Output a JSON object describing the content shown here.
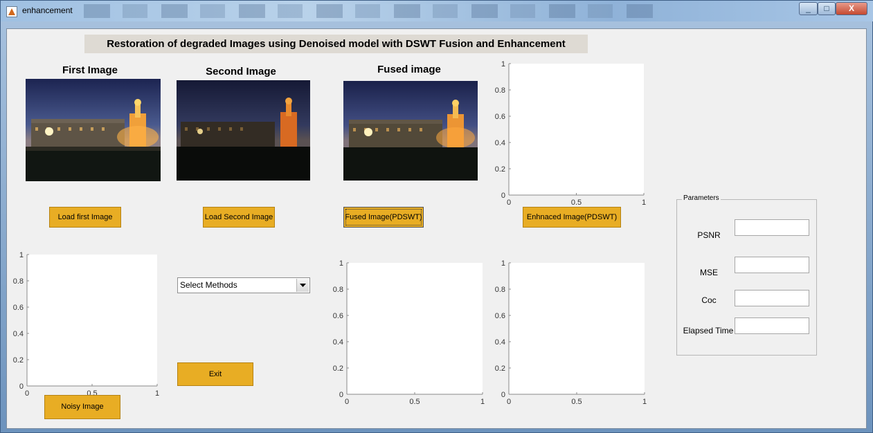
{
  "window": {
    "title": "enhancement",
    "minimize_symbol": "_",
    "maximize_symbol": "□",
    "close_symbol": "X"
  },
  "header": {
    "title": "Restoration of degraded Images using Denoised model with DSWT Fusion and Enhancement"
  },
  "images": {
    "first_title": "First Image",
    "second_title": "Second Image",
    "fused_title": "Fused image"
  },
  "buttons": {
    "load_first": "Load first Image",
    "load_second": "Load Second Image",
    "fused": "Fused Image(PDSWT)",
    "enhanced": "Enhnaced Image(PDSWT)",
    "noisy": "Noisy Image",
    "exit": "Exit"
  },
  "select_methods": {
    "value": "Select Methods"
  },
  "parameters": {
    "legend": "Parameters",
    "psnr_label": "PSNR",
    "mse_label": "MSE",
    "coc_label": "Coc",
    "elapsed_label": "Elapsed Time"
  },
  "axes_ticks": {
    "y": [
      "0",
      "0.2",
      "0.4",
      "0.6",
      "0.8",
      "1"
    ],
    "x": [
      "0",
      "0.5",
      "1"
    ]
  },
  "colors": {
    "button": "#e8ad24",
    "panel": "#f0f0f0"
  }
}
